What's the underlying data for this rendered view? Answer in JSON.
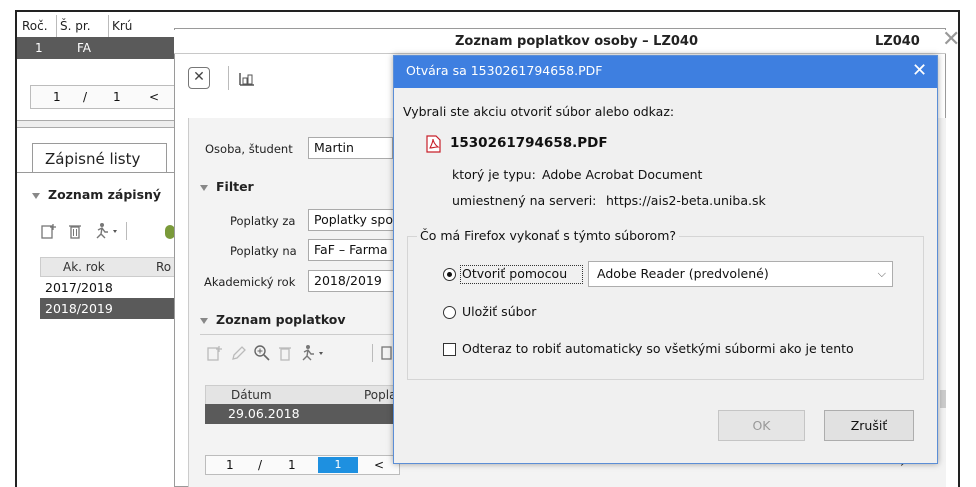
{
  "bg_window": {
    "columns": [
      "Roč.",
      "Š. pr.",
      "Krú"
    ],
    "selected_row": {
      "roc": "1",
      "spr": "FA"
    },
    "pager": {
      "page": "1",
      "sep": "/",
      "total": "1",
      "prev": "<"
    },
    "tab_label": "Zápisné listy",
    "section_title": "Zoznam zápisný",
    "table_headers": [
      "Ak. rok",
      "Ro"
    ],
    "rows": [
      "2017/2018",
      "2018/2019"
    ]
  },
  "middle_dialog": {
    "title": "Zoznam poplatkov osoby – LZ040",
    "code": "LZ040",
    "close_glyph": "✕",
    "close_btn_glyph": "✕",
    "person_label": "Osoba, študent",
    "person_value": "Martin",
    "filter_title": "Filter",
    "fees_for_label": "Poplatky za",
    "fees_for_value": "Poplatky spo",
    "fees_on_label": "Poplatky na",
    "fees_on_value": "FaF – Farma",
    "year_label": "Akademický rok",
    "year_value": "2018/2019",
    "list_title": "Zoznam poplatkov",
    "table_headers": [
      "Dátum",
      "Popla"
    ],
    "row_date": "29.06.2018",
    "pager": {
      "page": "1",
      "sep": "/",
      "total": "1",
      "current": "1",
      "prev": "<"
    },
    "right_nav": "›"
  },
  "firefox_dialog": {
    "title": "Otvára sa 1530261794658.PDF",
    "close_glyph": "✕",
    "intro": "Vybrali ste akciu otvoriť súbor alebo odkaz:",
    "filename": "1530261794658.PDF",
    "type_label": "ktorý je typu:",
    "type_value": "Adobe Acrobat Document",
    "location_label": "umiestnený na serveri:",
    "location_value": "https://ais2-beta.uniba.sk",
    "question": "Čo má Firefox vykonať s týmto súborom?",
    "open_with_label": "Otvoriť pomocou",
    "open_with_app": "Adobe Reader  (predvolené)",
    "save_label": "Uložiť súbor",
    "auto_label": "Odteraz to robiť automaticky so všetkými súbormi ako je tento",
    "ok_label": "OK",
    "cancel_label": "Zrušiť"
  },
  "colors": {
    "firefox_title_bar": "#3e7fe0",
    "selected_row": "#5a5a5a",
    "pager_current": "#1e90e0",
    "pdf_icon": "#c8202a"
  }
}
